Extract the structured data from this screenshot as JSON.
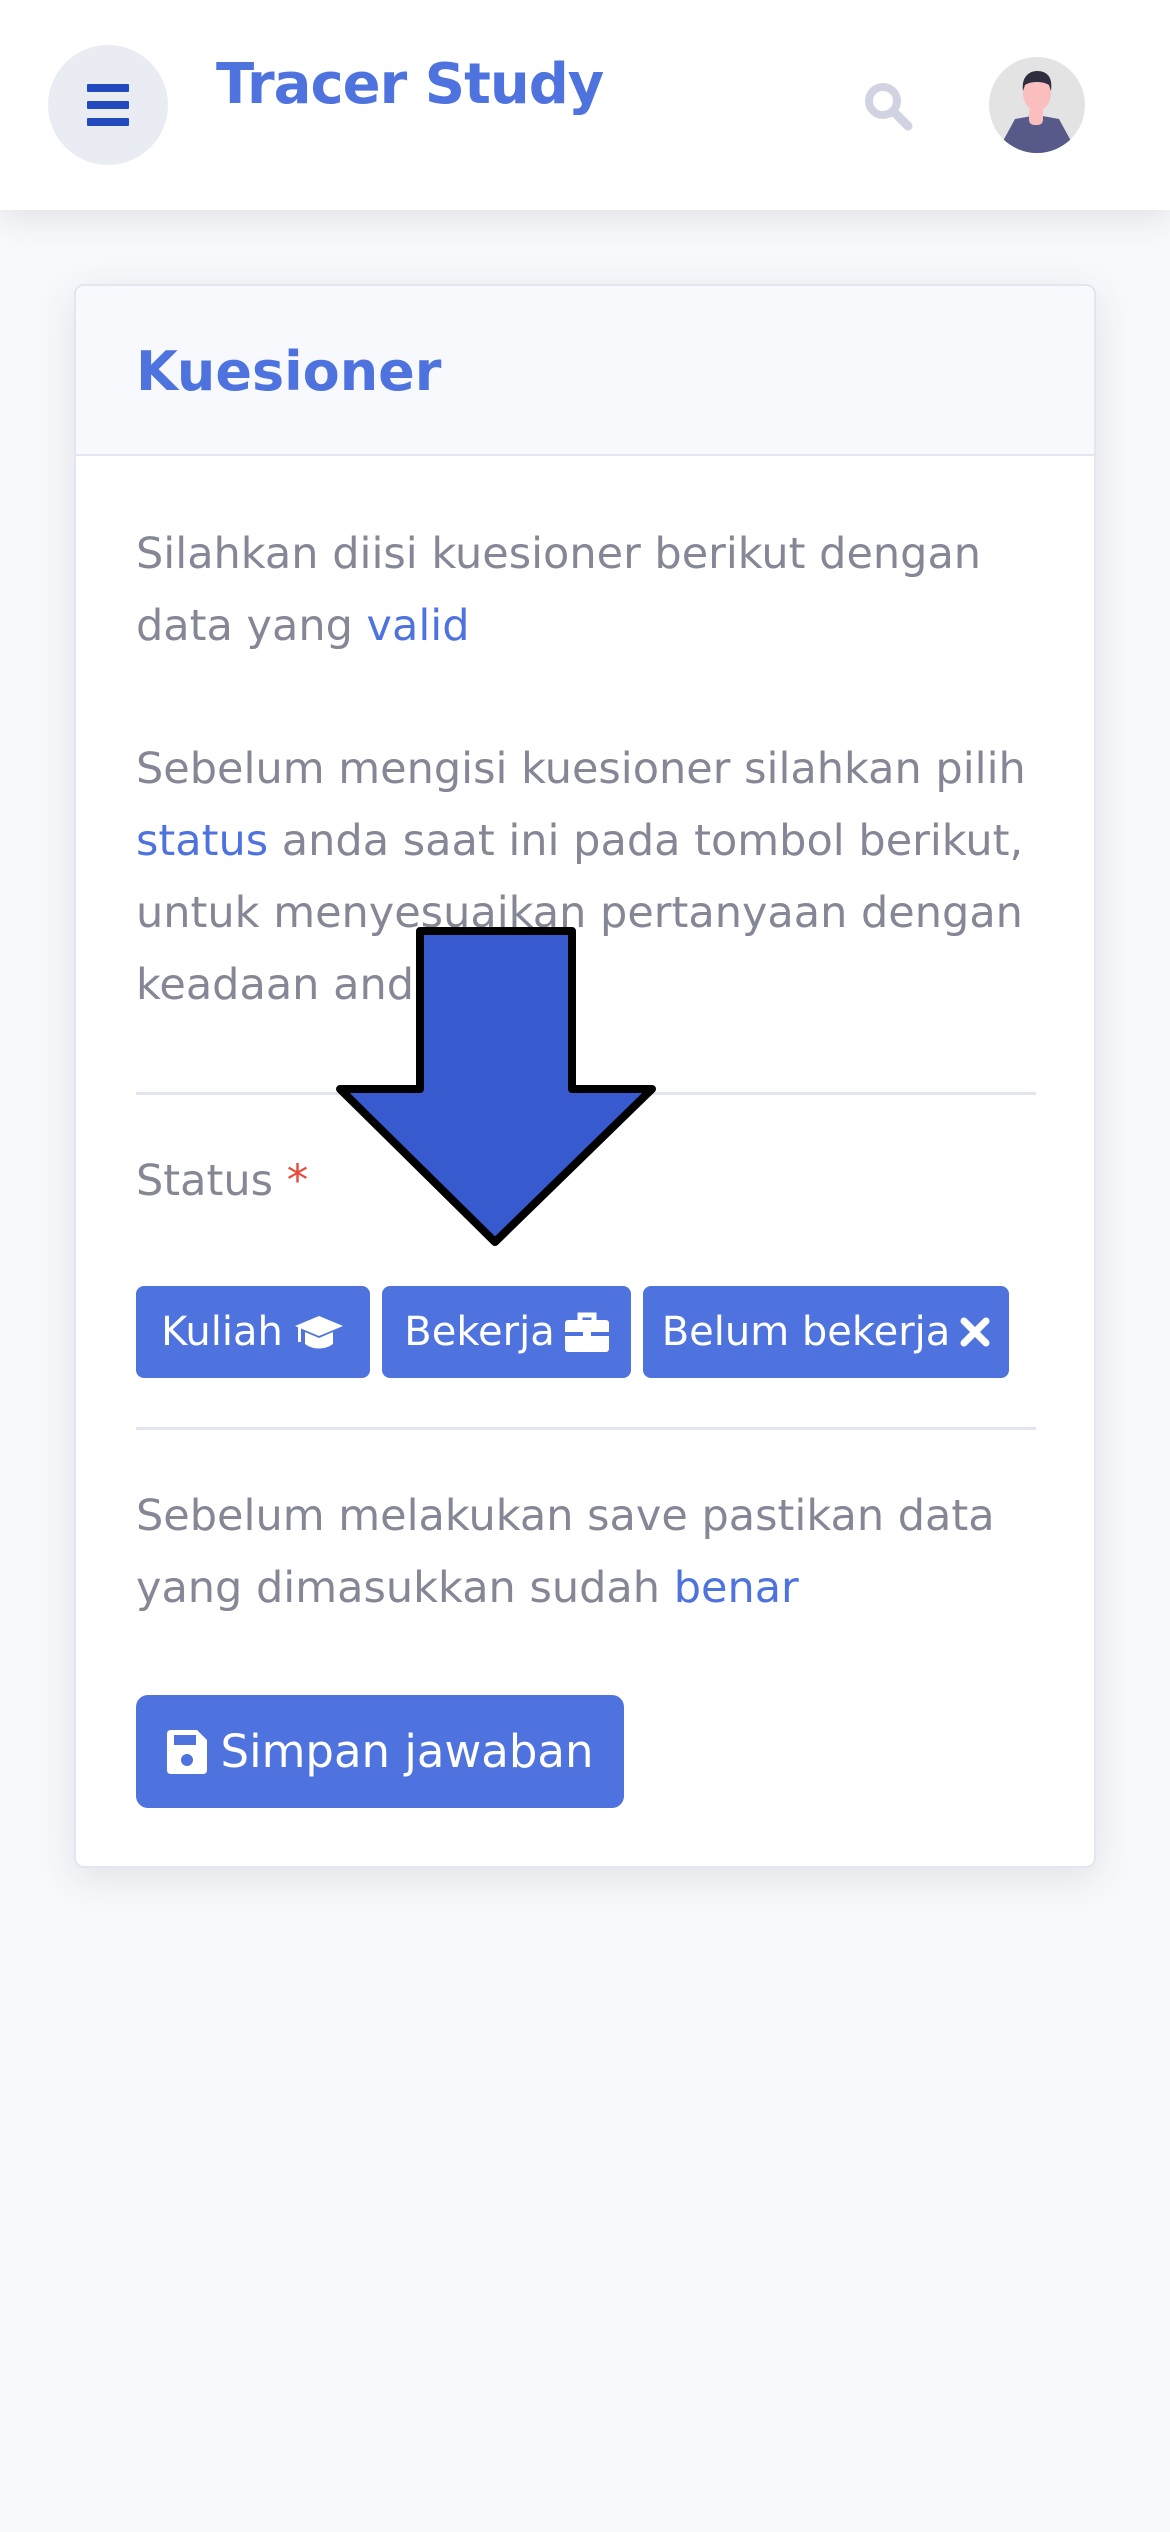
{
  "header": {
    "title": "Tracer Study",
    "menu_icon": "bars-icon",
    "search_icon": "search-icon",
    "avatar_icon": "user-avatar"
  },
  "card": {
    "title": "Kuesioner",
    "intro": {
      "text": "Silahkan diisi kuesioner berikut dengan data yang ",
      "highlight": "valid"
    },
    "instruction": {
      "before": "Sebelum mengisi kuesioner silahkan pilih ",
      "highlight": "status",
      "after": " anda saat ini pada tombol berikut, untuk menyesuaikan pertanyaan dengan keadaan anda"
    },
    "status_label": "Status",
    "required_mark": "*",
    "status_buttons": [
      {
        "label": "Kuliah",
        "icon": "graduation-cap-icon"
      },
      {
        "label": "Bekerja",
        "icon": "briefcase-icon"
      },
      {
        "label": "Belum bekerja",
        "icon": "times-icon"
      }
    ],
    "save_note": {
      "text": "Sebelum melakukan save pastikan data yang dimasukkan sudah ",
      "highlight": "benar"
    },
    "save_button": {
      "label": "Simpan jawaban",
      "icon": "save-icon"
    }
  },
  "annotation": {
    "icon": "down-arrow-annotation",
    "color": "#375bce"
  },
  "colors": {
    "primary": "#4e73df",
    "text": "#858796",
    "required": "#e74a3b"
  }
}
